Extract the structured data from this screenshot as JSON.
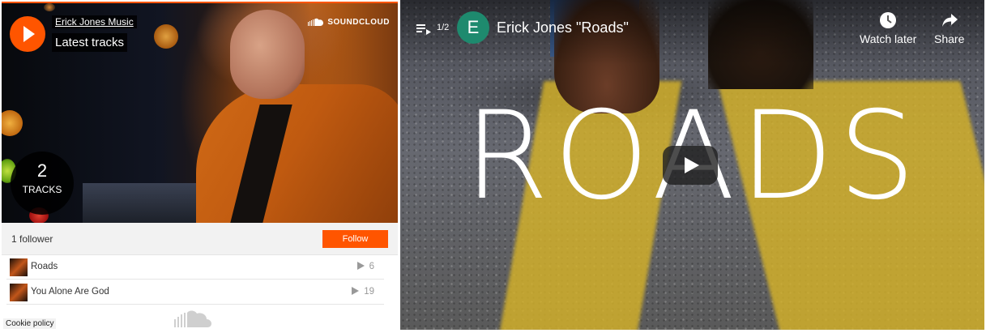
{
  "soundcloud": {
    "username": "Erick Jones Music",
    "title": "Latest tracks",
    "brand": "SOUNDCLOUD",
    "track_count": "2",
    "track_count_label": "TRACKS",
    "followers": "1 follower",
    "follow_label": "Follow",
    "cookie_policy": "Cookie policy",
    "accent_color": "#ff5500",
    "tracks": [
      {
        "name": "Roads",
        "plays": "6"
      },
      {
        "name": "You Alone Are God",
        "plays": "19"
      }
    ]
  },
  "youtube": {
    "playlist_position": "1/2",
    "channel_initial": "E",
    "video_title": "Erick Jones \"Roads\"",
    "thumbnail_text": "ROADS",
    "watch_later_label": "Watch later",
    "share_label": "Share",
    "avatar_color": "#1e8a6e"
  }
}
